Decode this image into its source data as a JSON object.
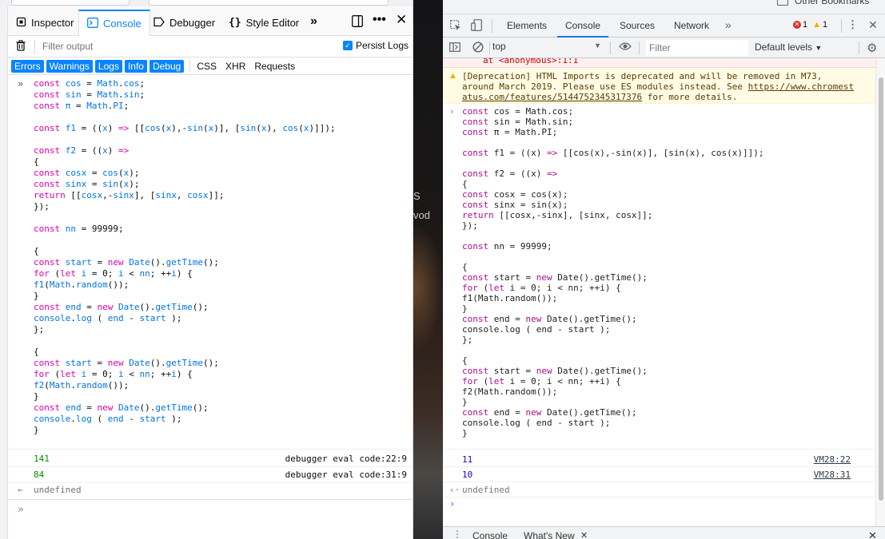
{
  "firefox": {
    "tabs": {
      "inspector": "Inspector",
      "console": "Console",
      "debugger": "Debugger",
      "style_editor": "Style Editor"
    },
    "filter_placeholder": "Filter output",
    "persist_logs": "Persist Logs",
    "categories": {
      "errors": "Errors",
      "warnings": "Warnings",
      "logs": "Logs",
      "info": "Info",
      "debug": "Debug",
      "css": "CSS",
      "xhr": "XHR",
      "requests": "Requests"
    },
    "results": [
      {
        "value": "141",
        "location": "debugger eval code:22:9"
      },
      {
        "value": "84",
        "location": "debugger eval code:31:9"
      }
    ],
    "undefined_text": "undefined"
  },
  "chrome": {
    "bookmarks_label": "Other Bookmarks",
    "tabs": {
      "elements": "Elements",
      "console": "Console",
      "sources": "Sources",
      "network": "Network"
    },
    "error_count": "1",
    "warning_count": "1",
    "context": "top",
    "filter_placeholder": "Filter",
    "levels": "Default levels",
    "error_tail": "at <anonymous>:1:1",
    "warning_text_1": "[Deprecation] HTML Imports is deprecated and will be removed in M73,",
    "warning_text_2": "around March 2019. Please use ES modules instead. See ",
    "warning_link_1": "https://www.chromest",
    "warning_link_2": "atus.com/features/5144752345317376",
    "warning_text_3": " for more details.",
    "results": [
      {
        "value": "11",
        "location": "VM28:22"
      },
      {
        "value": "10",
        "location": "VM28:31"
      }
    ],
    "undefined_text": "undefined",
    "drawer_tabs": {
      "console": "Console",
      "whats_new": "What's New"
    }
  },
  "background_fragments": {
    "a": "S",
    "b": "vod"
  },
  "colors": {
    "firefox_accent": "#0a84ff",
    "chrome_accent": "#1a73e8",
    "result_green": "#058b00"
  }
}
